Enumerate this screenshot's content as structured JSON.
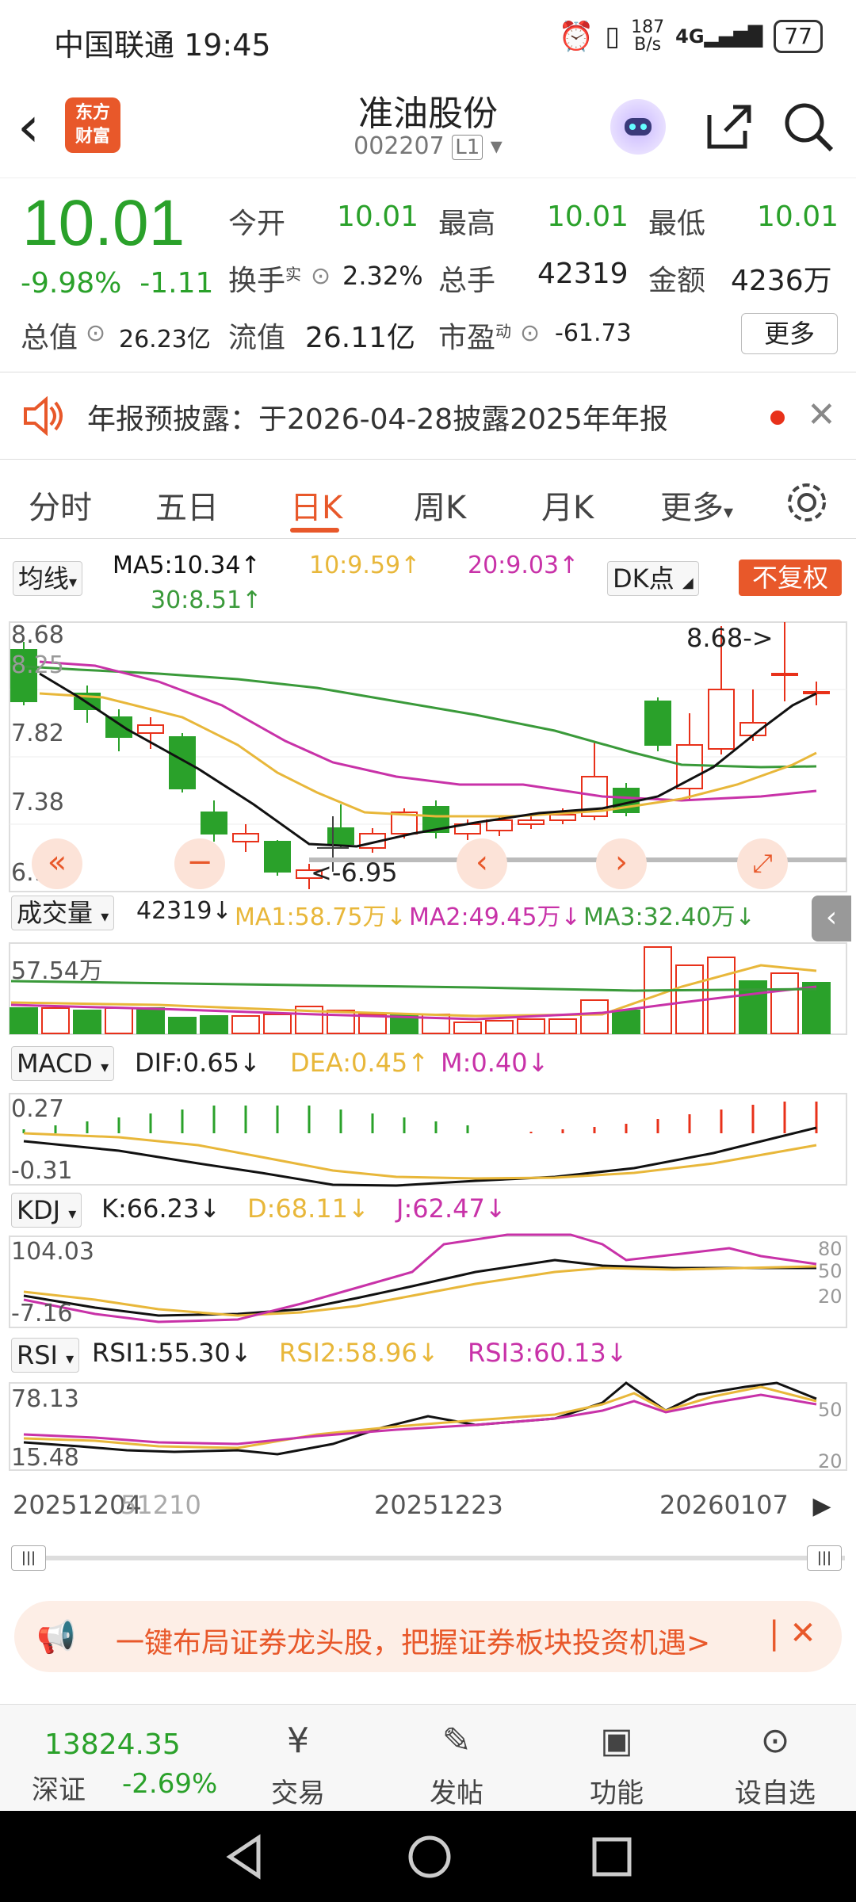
{
  "status": {
    "carrier": "中国联通 19:45",
    "speed_top": "187",
    "speed_bottom": "B/s",
    "network": "4G",
    "battery": "77"
  },
  "header": {
    "logo_line1": "东方",
    "logo_line2": "财富",
    "stock_name": "准油股份",
    "stock_code": "002207",
    "level": "L1"
  },
  "quote": {
    "price": "10.01",
    "pct": "-9.98%",
    "change": "-1.11",
    "open_label": "今开",
    "open": "10.01",
    "high_label": "最高",
    "high": "10.01",
    "low_label": "最低",
    "low": "10.01",
    "turnover_label": "换手",
    "turnover_sup": "实",
    "turnover": "2.32%",
    "volume_label": "总手",
    "volume": "42319",
    "amount_label": "金额",
    "amount": "4236万",
    "mcap_label": "总值",
    "mcap": "26.23亿",
    "float_label": "流值",
    "float": "26.11亿",
    "pe_label": "市盈",
    "pe_sup": "动",
    "pe": "-61.73",
    "more": "更多"
  },
  "notice": {
    "text": "年报预披露：于2026-04-28披露2025年年报"
  },
  "tabs": [
    "分时",
    "五日",
    "日K",
    "周K",
    "月K",
    "更多"
  ],
  "ma": {
    "select": "均线",
    "ma5": "MA5:10.34↑",
    "ma10": "10:9.59↑",
    "ma20": "20:9.03↑",
    "ma30": "30:8.51↑",
    "dk": "DK点",
    "fq": "不复权"
  },
  "kline": {
    "ytop": "8.68",
    "y2": "8.25",
    "y3": "7.82",
    "y4": "7.38",
    "ybottom": "6.95",
    "max_label": "8.68->",
    "min_label": "<-6.95"
  },
  "vol": {
    "select": "成交量",
    "v": "42319↓",
    "ma1": "MA1:58.75万↓",
    "ma2": "MA2:49.45万↓",
    "ma3": "MA3:32.40万↓",
    "ymax": "57.54万"
  },
  "macd": {
    "select": "MACD",
    "dif": "DIF:0.65↓",
    "dea": "DEA:0.45↑",
    "m": "M:0.40↓",
    "ytop": "0.27",
    "ybot": "-0.31"
  },
  "kdj": {
    "select": "KDJ",
    "k": "K:66.23↓",
    "d": "D:68.11↓",
    "j": "J:62.47↓",
    "ytop": "104.03",
    "ybot": "-7.16",
    "r80": "80",
    "r50": "50",
    "r20": "20"
  },
  "rsi": {
    "select": "RSI",
    "r1": "RSI1:55.30↓",
    "r2": "RSI2:58.96↓",
    "r3": "RSI3:60.13↓",
    "ytop": "78.13",
    "ybot": "15.48",
    "r50": "50",
    "r20": "20"
  },
  "xaxis": {
    "d1": "20251204",
    "d2": "51210",
    "d3": "20251223",
    "d4": "20260107"
  },
  "banner": {
    "text": "一键布局证券龙头股，把握证券板块投资机遇>"
  },
  "bottom": {
    "index_value": "13824.35",
    "index_name": "深证",
    "index_pct": "-2.69%",
    "trade": "交易",
    "post": "发帖",
    "func": "功能",
    "watch": "设自选"
  },
  "colors": {
    "up": "#e8311a",
    "down": "#2aa12a",
    "ma5": "#111111",
    "ma10": "#e8b73a",
    "ma20": "#c832a8",
    "ma30": "#3a9a3a",
    "accent": "#e8582a"
  }
}
